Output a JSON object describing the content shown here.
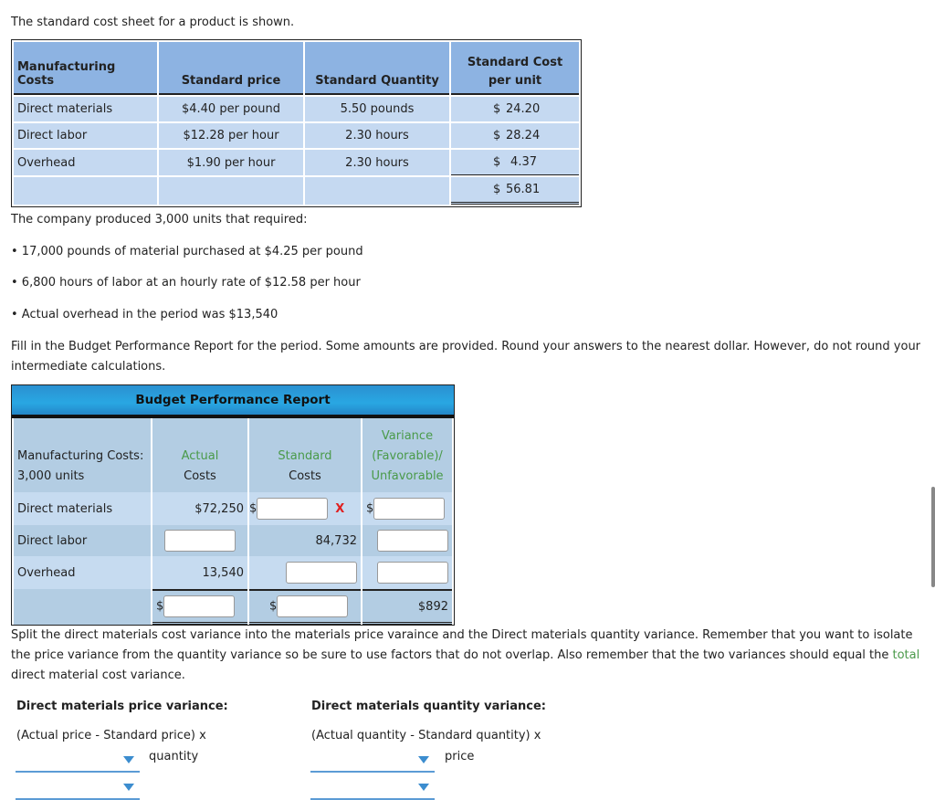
{
  "intro": "The standard cost sheet for a product is shown.",
  "cost_sheet": {
    "headers": [
      "Manufacturing Costs",
      "Standard price",
      "Standard Quantity",
      "Standard Cost",
      "per unit"
    ],
    "rows": [
      {
        "label": "Direct materials",
        "price": "$4.40 per pound",
        "qty": "5.50 pounds",
        "cur": "$",
        "cost": "24.20"
      },
      {
        "label": "Direct labor",
        "price": "$12.28 per hour",
        "qty": "2.30 hours",
        "cur": "$",
        "cost": "28.24"
      },
      {
        "label": "Overhead",
        "price": "$1.90 per hour",
        "qty": "2.30 hours",
        "cur": "$",
        "cost": "4.37"
      }
    ],
    "total": {
      "cur": "$",
      "cost": "56.81"
    }
  },
  "production": {
    "lead": "The company produced 3,000 units that required:",
    "bullets": [
      "• 17,000 pounds of material purchased at $4.25 per pound",
      "• 6,800 hours of labor at an hourly rate of $12.58 per hour",
      "• Actual overhead in the period was $13,540"
    ]
  },
  "instructions": "Fill in the Budget Performance Report for the period. Some amounts are provided. Round your answers to the nearest dollar. However, do not round your intermediate calculations.",
  "report": {
    "title": "Budget Performance Report",
    "headers": {
      "col1_line1": "Manufacturing Costs:",
      "col1_line2": "3,000 units",
      "actual_line1": "Actual",
      "actual_line2": "Costs",
      "standard_line1": "Standard",
      "standard_line2": "Costs",
      "variance_line1": "Variance",
      "variance_line2": "(Favorable)/",
      "variance_line3": "Unfavorable"
    },
    "rows": {
      "dm": {
        "label": "Direct materials",
        "actual": "$72,250",
        "standard_prefix": "$",
        "standard_value": "",
        "mark": "X",
        "variance_prefix": "$",
        "variance_value": ""
      },
      "dl": {
        "label": "Direct labor",
        "actual_value": "",
        "standard": "84,732",
        "variance_value": ""
      },
      "oh": {
        "label": "Overhead",
        "actual": "13,540",
        "standard_value": "",
        "variance_value": ""
      },
      "total": {
        "actual_prefix": "$",
        "actual_value": "",
        "standard_prefix": "$",
        "standard_value": "",
        "variance": "$892"
      }
    }
  },
  "split_text_1": "Split the direct materials cost variance into the materials price varaince and the Direct materials quantity variance. Remember that you want to isolate the price variance from the quantity variance so be sure to use factors that do not overlap. Also remember that the two variances should equal the ",
  "split_link": "total",
  "split_text_2": "direct material cost variance.",
  "price_variance": {
    "title": "Direct materials price variance:",
    "formula": "(Actual price - Standard price) x",
    "suffix": "quantity",
    "dropdown1": "",
    "dropdown2": ""
  },
  "quantity_variance": {
    "title": "Direct materials quantity variance:",
    "formula": "(Actual quantity - Standard quantity) x",
    "suffix": "price",
    "dropdown1": "",
    "dropdown2": ""
  }
}
